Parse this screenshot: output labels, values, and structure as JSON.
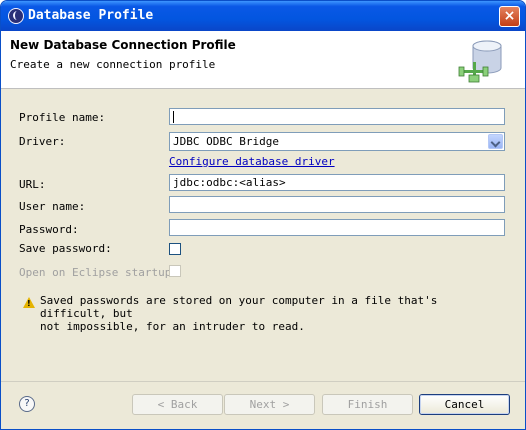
{
  "window": {
    "title": "Database Profile",
    "close_glyph": "×"
  },
  "header": {
    "title": "New Database Connection Profile",
    "description": "Create a new connection profile",
    "icon": "database-connection-icon"
  },
  "form": {
    "profile_name": {
      "label": "Profile name:",
      "value": ""
    },
    "driver": {
      "label": "Driver:",
      "value": "JDBC ODBC Bridge"
    },
    "configure_link": "Configure database driver",
    "url": {
      "label": "URL:",
      "value": "jdbc:odbc:<alias>"
    },
    "user_name": {
      "label": "User name:",
      "value": ""
    },
    "password": {
      "label": "Password:",
      "value": ""
    },
    "save_password": {
      "label": "Save password:",
      "checked": false
    },
    "open_on_startup": {
      "label": "Open on Eclipse startup:",
      "checked": false,
      "disabled": true
    }
  },
  "warning": {
    "text": "Saved passwords are stored on your computer in a file that's difficult, but\nnot impossible, for an intruder to read.",
    "icon": "warning-icon"
  },
  "footer": {
    "help_glyph": "?",
    "back_label": "< Back",
    "next_label": "Next >",
    "finish_label": "Finish",
    "cancel_label": "Cancel"
  },
  "colors": {
    "titlebar": "#0a58e6",
    "dialog_bg": "#ece9d8",
    "link": "#0000c0",
    "warning": "#e5b300"
  }
}
